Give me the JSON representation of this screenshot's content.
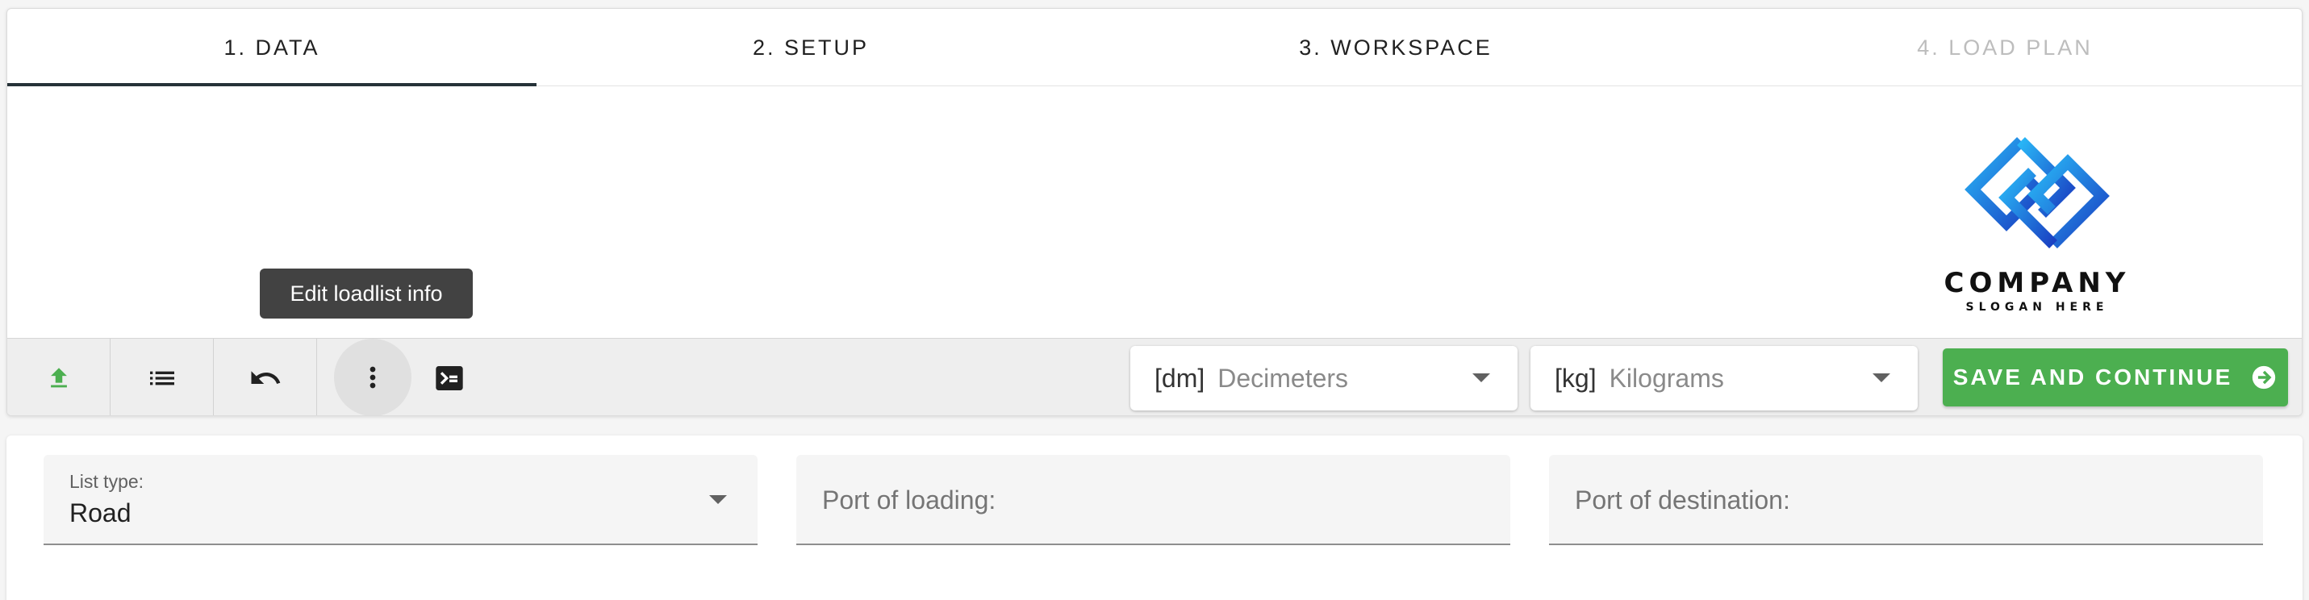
{
  "tabs": [
    {
      "label": "1. DATA",
      "active": true
    },
    {
      "label": "2. SETUP",
      "active": false
    },
    {
      "label": "3. WORKSPACE",
      "active": false
    },
    {
      "label": "4. LOAD PLAN",
      "disabled": true
    }
  ],
  "logo": {
    "name": "COMPANY",
    "slogan": "SLOGAN HERE"
  },
  "tooltip": "Edit loadlist info",
  "toolbar": {
    "icons": [
      "upload-icon",
      "list-icon",
      "undo-icon",
      "more-vert-icon",
      "console-icon"
    ],
    "length_unit": {
      "prefix": "[dm]",
      "value": "Decimeters"
    },
    "weight_unit": {
      "prefix": "[kg]",
      "value": "Kilograms"
    },
    "save_label": "SAVE AND CONTINUE"
  },
  "form": {
    "list_type": {
      "label": "List type:",
      "value": "Road"
    },
    "port_loading": {
      "placeholder": "Port of loading:"
    },
    "port_destination": {
      "placeholder": "Port of destination:"
    }
  },
  "colors": {
    "accent_green": "#4caf50",
    "tab_indicator": "#263238"
  }
}
